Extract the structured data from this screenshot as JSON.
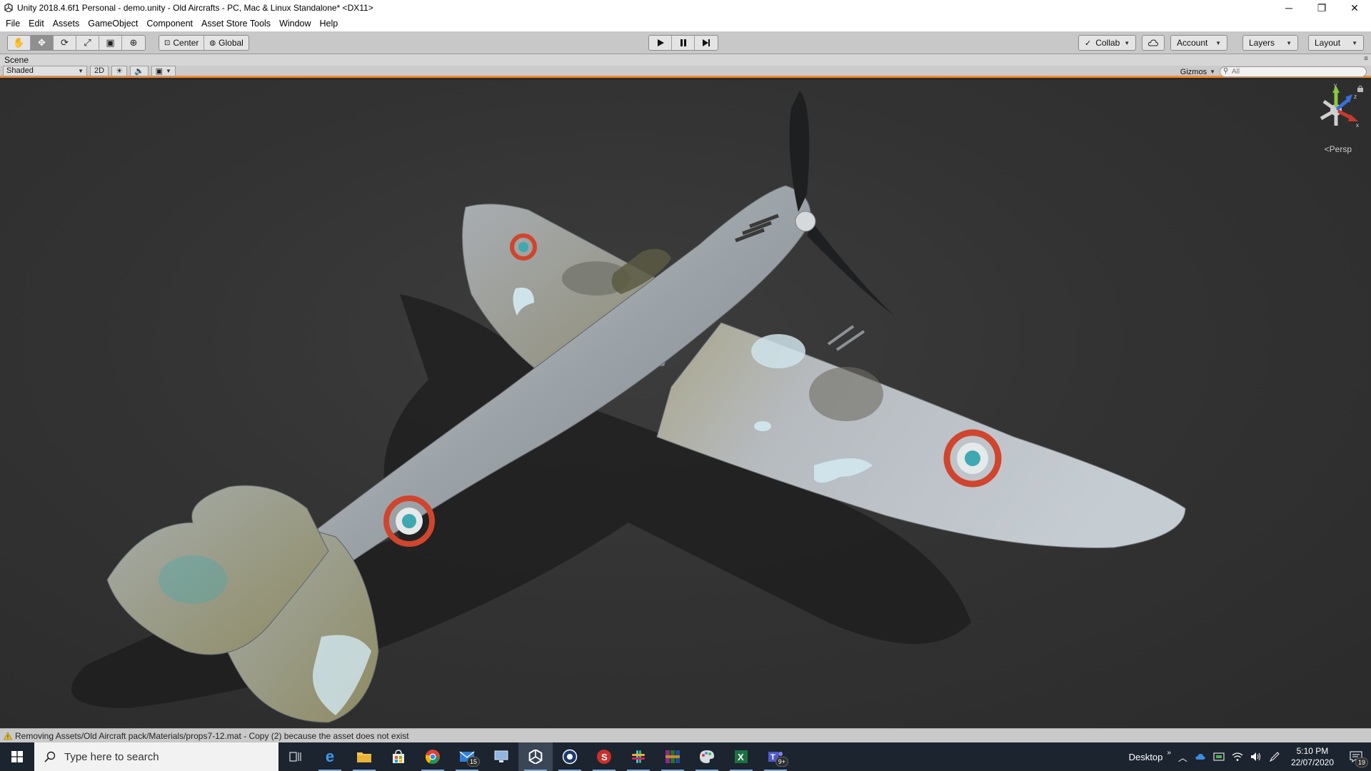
{
  "window": {
    "title": "Unity 2018.4.6f1 Personal - demo.unity - Old Aircrafts - PC, Mac & Linux Standalone* <DX11>",
    "minimize": "─",
    "restore": "❐",
    "close": "✕"
  },
  "menu": [
    "File",
    "Edit",
    "Assets",
    "GameObject",
    "Component",
    "Asset Store Tools",
    "Window",
    "Help"
  ],
  "toolbar": {
    "transform_tools": [
      {
        "name": "hand-tool",
        "glyph": "✋"
      },
      {
        "name": "move-tool",
        "glyph": "✥"
      },
      {
        "name": "rotate-tool",
        "glyph": "⟳"
      },
      {
        "name": "scale-tool",
        "glyph": "⤢"
      },
      {
        "name": "rect-tool",
        "glyph": "▣"
      },
      {
        "name": "transform-tool",
        "glyph": "⊕"
      }
    ],
    "pivot_center": "Center",
    "pivot_global": "Global",
    "collab": "Collab",
    "account": "Account",
    "layers": "Layers",
    "layout": "Layout"
  },
  "scene": {
    "tab_label": "Scene",
    "shading_mode": "Shaded",
    "mode_2d": "2D",
    "gizmos": "Gizmos",
    "search_placeholder": "All",
    "projection": "Persp",
    "axis_y": "y",
    "axis_z": "z",
    "axis_x": "x"
  },
  "status": {
    "message": "Removing Assets/Old Aircraft pack/Materials/props7-12.mat - Copy (2) because the asset does not exist"
  },
  "taskbar": {
    "search_placeholder": "Type here to search",
    "mail_badge": "15",
    "teams_badge": "9+",
    "desktop_label": "Desktop",
    "time": "5:10 PM",
    "date": "22/07/2020",
    "notification_count": "19"
  },
  "colors": {
    "accent_orange": "#f28a2e",
    "toolbar_bg": "#c8c8c8",
    "viewport_bg": "#333333",
    "taskbar_bg": "#1c2430"
  }
}
